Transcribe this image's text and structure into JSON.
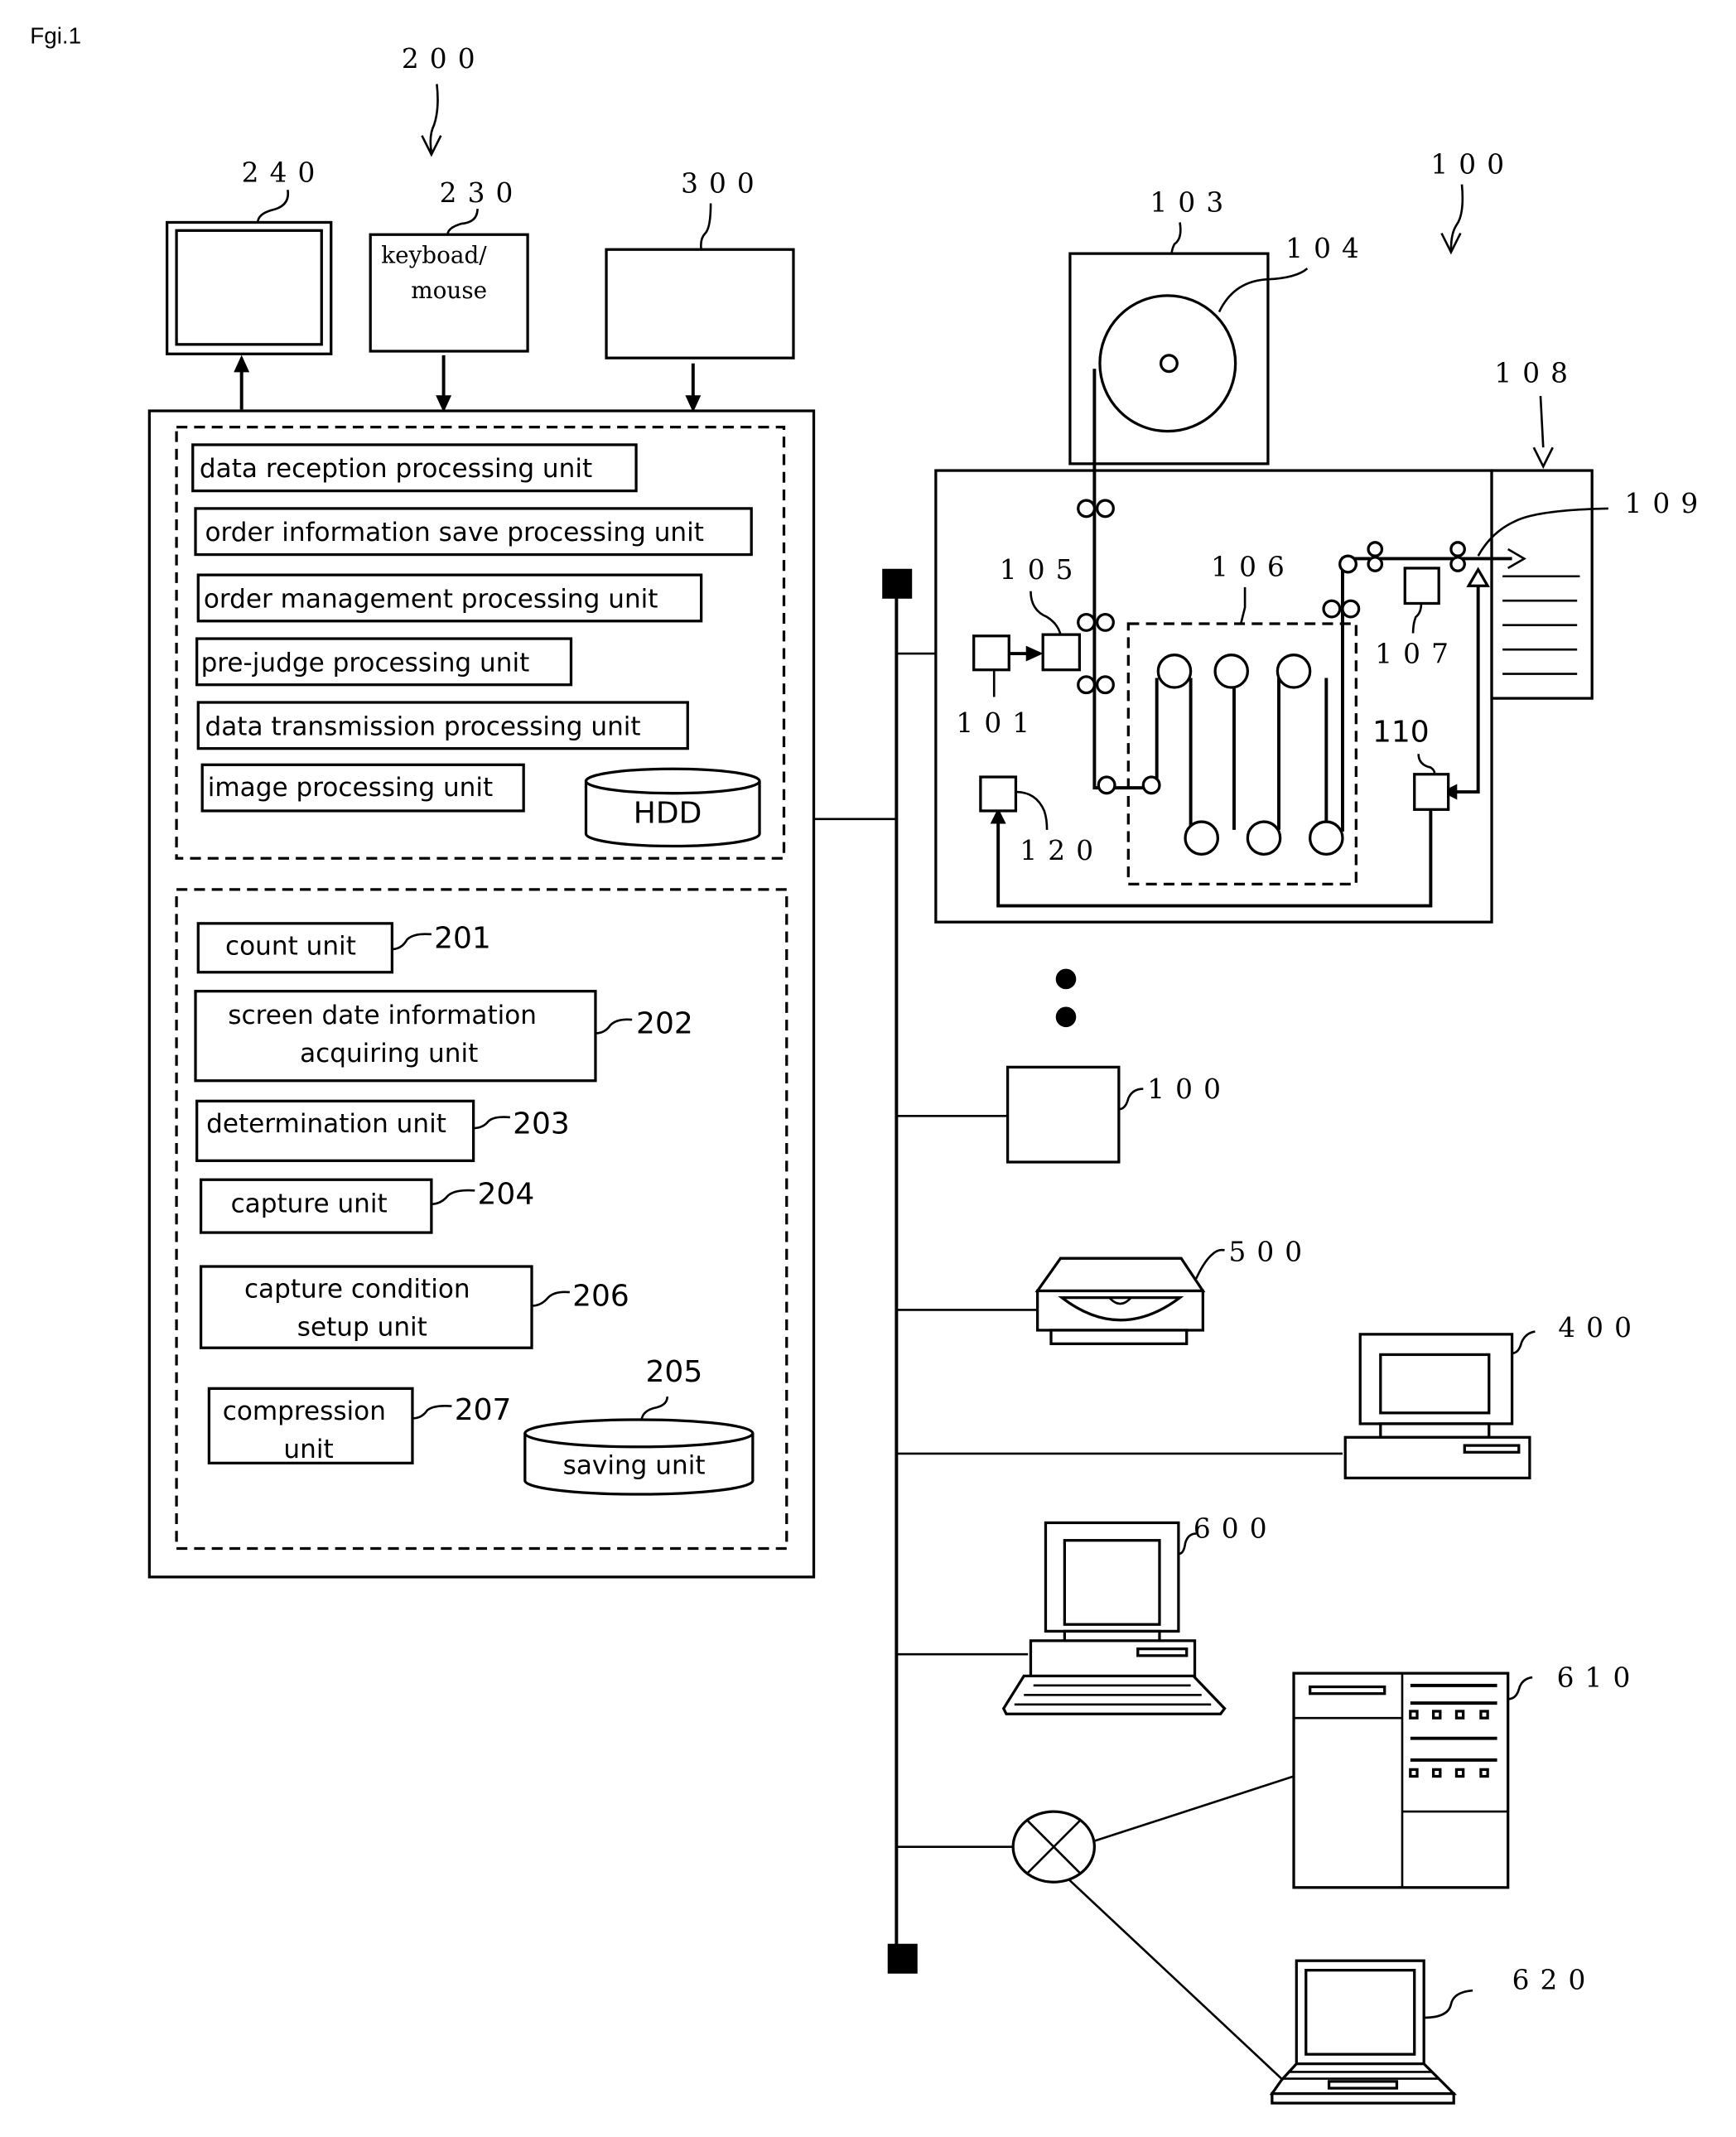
{
  "figure": {
    "title": "Fgi.1"
  },
  "system_200": {
    "ref": "200",
    "monitor": {
      "ref": "240"
    },
    "keyboard_mouse": {
      "ref": "230",
      "label_line1": "keyboad/",
      "label_line2": "mouse"
    },
    "device_300": {
      "ref": "300"
    },
    "upper_units": [
      {
        "label": "data reception processing unit"
      },
      {
        "label": "order information save processing unit"
      },
      {
        "label": "order management processing unit"
      },
      {
        "label": "pre-judge processing unit"
      },
      {
        "label": "data transmission processing unit"
      },
      {
        "label": "image processing unit"
      }
    ],
    "hdd": {
      "label": "HDD"
    },
    "lower_units": [
      {
        "ref": "201",
        "line1": "count unit",
        "line2": ""
      },
      {
        "ref": "202",
        "line1": "screen date information",
        "line2": "acquiring unit"
      },
      {
        "ref": "203",
        "line1": "determination unit",
        "line2": ""
      },
      {
        "ref": "204",
        "line1": "capture unit",
        "line2": ""
      },
      {
        "ref": "206",
        "line1": "capture condition",
        "line2": "setup unit"
      },
      {
        "ref": "207",
        "line1": "compression",
        "line2": "unit"
      }
    ],
    "saving_unit": {
      "ref": "205",
      "label": "saving unit"
    }
  },
  "printer_100": {
    "ref": "100",
    "parts": {
      "r101": "101",
      "r103": "103",
      "r104": "104",
      "r105": "105",
      "r106": "106",
      "r107": "107",
      "r108": "108",
      "r109": "109",
      "r110": "110",
      "r120": "120"
    }
  },
  "network": {
    "devices": [
      {
        "ref": "100",
        "kind": "printer-box"
      },
      {
        "ref": "500",
        "kind": "disc-drive"
      },
      {
        "ref": "400",
        "kind": "desktop-computer"
      },
      {
        "ref": "600",
        "kind": "desktop-computer-with-keyboard"
      },
      {
        "ref": "610",
        "kind": "server"
      },
      {
        "ref": "620",
        "kind": "laptop"
      }
    ],
    "router": {
      "kind": "router"
    }
  }
}
